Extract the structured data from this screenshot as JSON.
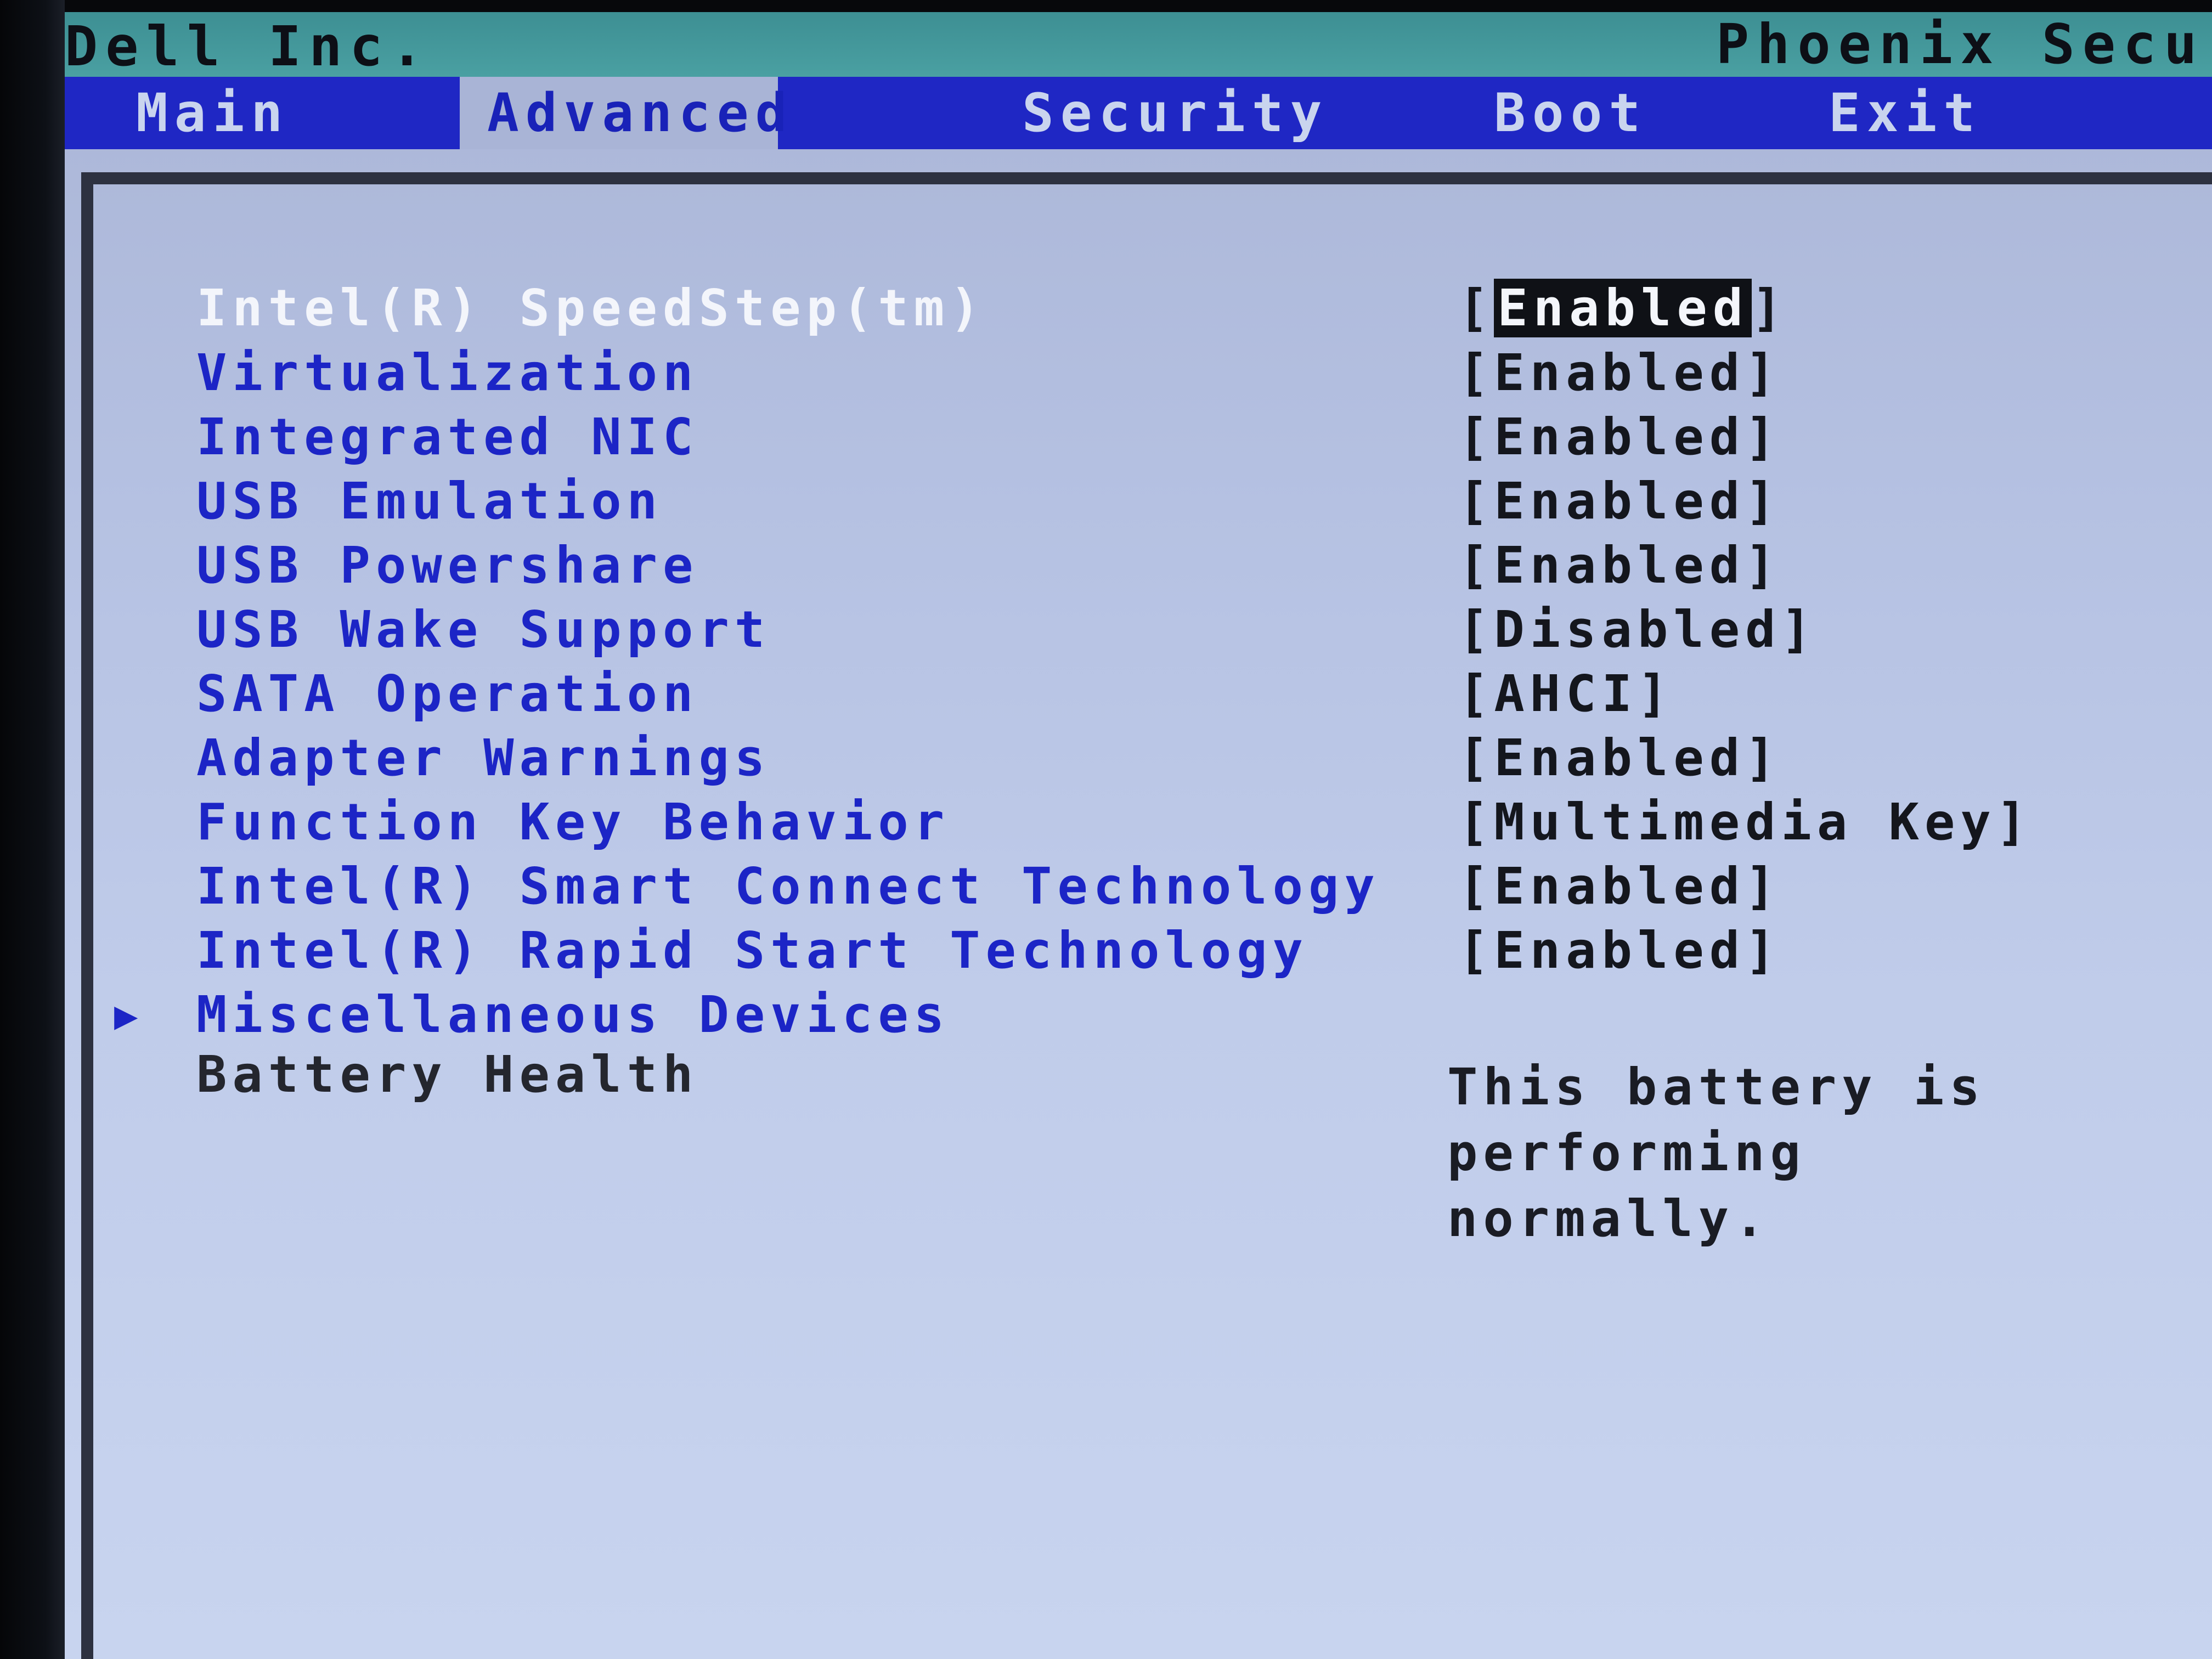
{
  "header": {
    "vendor": "Dell Inc.",
    "firmware": "Phoenix Secur"
  },
  "menu": {
    "tabs": [
      {
        "label": "Main",
        "active": false
      },
      {
        "label": "Advanced",
        "active": true
      },
      {
        "label": "Security",
        "active": false
      },
      {
        "label": "Boot",
        "active": false
      },
      {
        "label": "Exit",
        "active": false
      }
    ]
  },
  "settings": [
    {
      "label": "Intel(R) SpeedStep(tm)",
      "value": "Enabled",
      "selected": true
    },
    {
      "label": "Virtualization",
      "value": "Enabled"
    },
    {
      "label": "Integrated NIC",
      "value": "Enabled"
    },
    {
      "label": "USB Emulation",
      "value": "Enabled"
    },
    {
      "label": "USB Powershare",
      "value": "Enabled"
    },
    {
      "label": "USB Wake Support",
      "value": "Disabled"
    },
    {
      "label": "SATA Operation",
      "value": "AHCI"
    },
    {
      "label": "Adapter Warnings",
      "value": "Enabled"
    },
    {
      "label": "Function Key Behavior",
      "value": "Multimedia Key"
    },
    {
      "label": "Intel(R) Smart Connect Technology",
      "value": "Enabled"
    },
    {
      "label": "Intel(R) Rapid Start Technology",
      "value": "Enabled"
    }
  ],
  "submenu": {
    "arrow": "▶",
    "label": "Miscellaneous Devices"
  },
  "battery": {
    "label": "Battery Health",
    "status": "This battery is performing normally."
  },
  "colors": {
    "background": "#b5c1e2",
    "title_bar": "#4aa0a2",
    "menu_bar": "#1f27c4",
    "item_text": "#1c25c6",
    "highlight_text": "#f3f5fb",
    "value_text": "#14161d"
  }
}
